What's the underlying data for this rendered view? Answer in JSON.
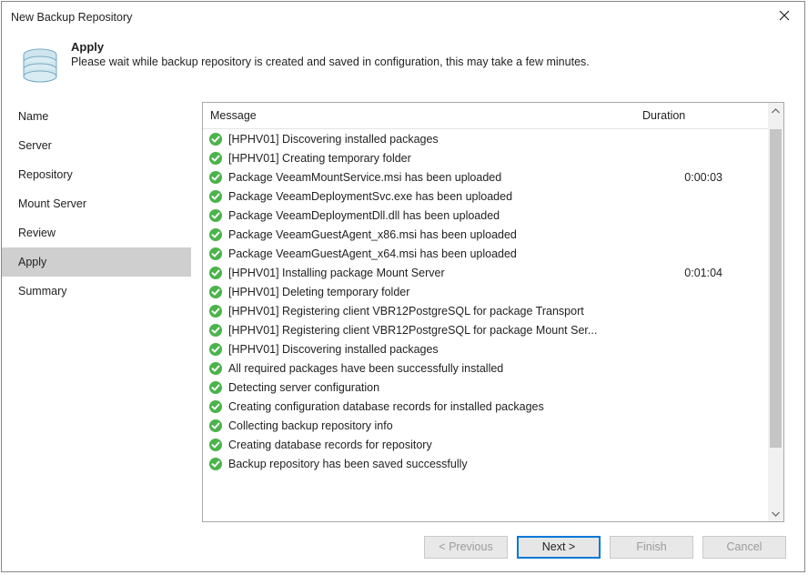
{
  "window": {
    "title": "New Backup Repository"
  },
  "header": {
    "title": "Apply",
    "description": "Please wait while backup repository is created and saved in configuration, this may take a few minutes."
  },
  "sidebar": {
    "items": [
      {
        "label": "Name",
        "active": false
      },
      {
        "label": "Server",
        "active": false
      },
      {
        "label": "Repository",
        "active": false
      },
      {
        "label": "Mount Server",
        "active": false
      },
      {
        "label": "Review",
        "active": false
      },
      {
        "label": "Apply",
        "active": true
      },
      {
        "label": "Summary",
        "active": false
      }
    ]
  },
  "grid": {
    "columns": {
      "message": "Message",
      "duration": "Duration"
    },
    "rows": [
      {
        "message": "[HPHV01] Discovering installed packages",
        "duration": ""
      },
      {
        "message": "[HPHV01] Creating temporary folder",
        "duration": ""
      },
      {
        "message": "Package VeeamMountService.msi has been uploaded",
        "duration": "0:00:03"
      },
      {
        "message": "Package VeeamDeploymentSvc.exe has been uploaded",
        "duration": ""
      },
      {
        "message": "Package VeeamDeploymentDll.dll has been uploaded",
        "duration": ""
      },
      {
        "message": "Package VeeamGuestAgent_x86.msi has been uploaded",
        "duration": ""
      },
      {
        "message": "Package VeeamGuestAgent_x64.msi has been uploaded",
        "duration": ""
      },
      {
        "message": "[HPHV01] Installing package Mount Server",
        "duration": "0:01:04"
      },
      {
        "message": "[HPHV01] Deleting temporary folder",
        "duration": ""
      },
      {
        "message": "[HPHV01] Registering client VBR12PostgreSQL for package Transport",
        "duration": ""
      },
      {
        "message": "[HPHV01] Registering client VBR12PostgreSQL for package Mount Ser...",
        "duration": ""
      },
      {
        "message": "[HPHV01] Discovering installed packages",
        "duration": ""
      },
      {
        "message": "All required packages have been successfully installed",
        "duration": ""
      },
      {
        "message": "Detecting server configuration",
        "duration": ""
      },
      {
        "message": "Creating configuration database records for installed packages",
        "duration": ""
      },
      {
        "message": "Collecting backup repository info",
        "duration": ""
      },
      {
        "message": "Creating database records for repository",
        "duration": ""
      },
      {
        "message": "Backup repository has been saved successfully",
        "duration": ""
      }
    ]
  },
  "footer": {
    "previous": "< Previous",
    "next": "Next >",
    "finish": "Finish",
    "cancel": "Cancel"
  },
  "icons": {
    "success_color": "#4bb34b"
  }
}
